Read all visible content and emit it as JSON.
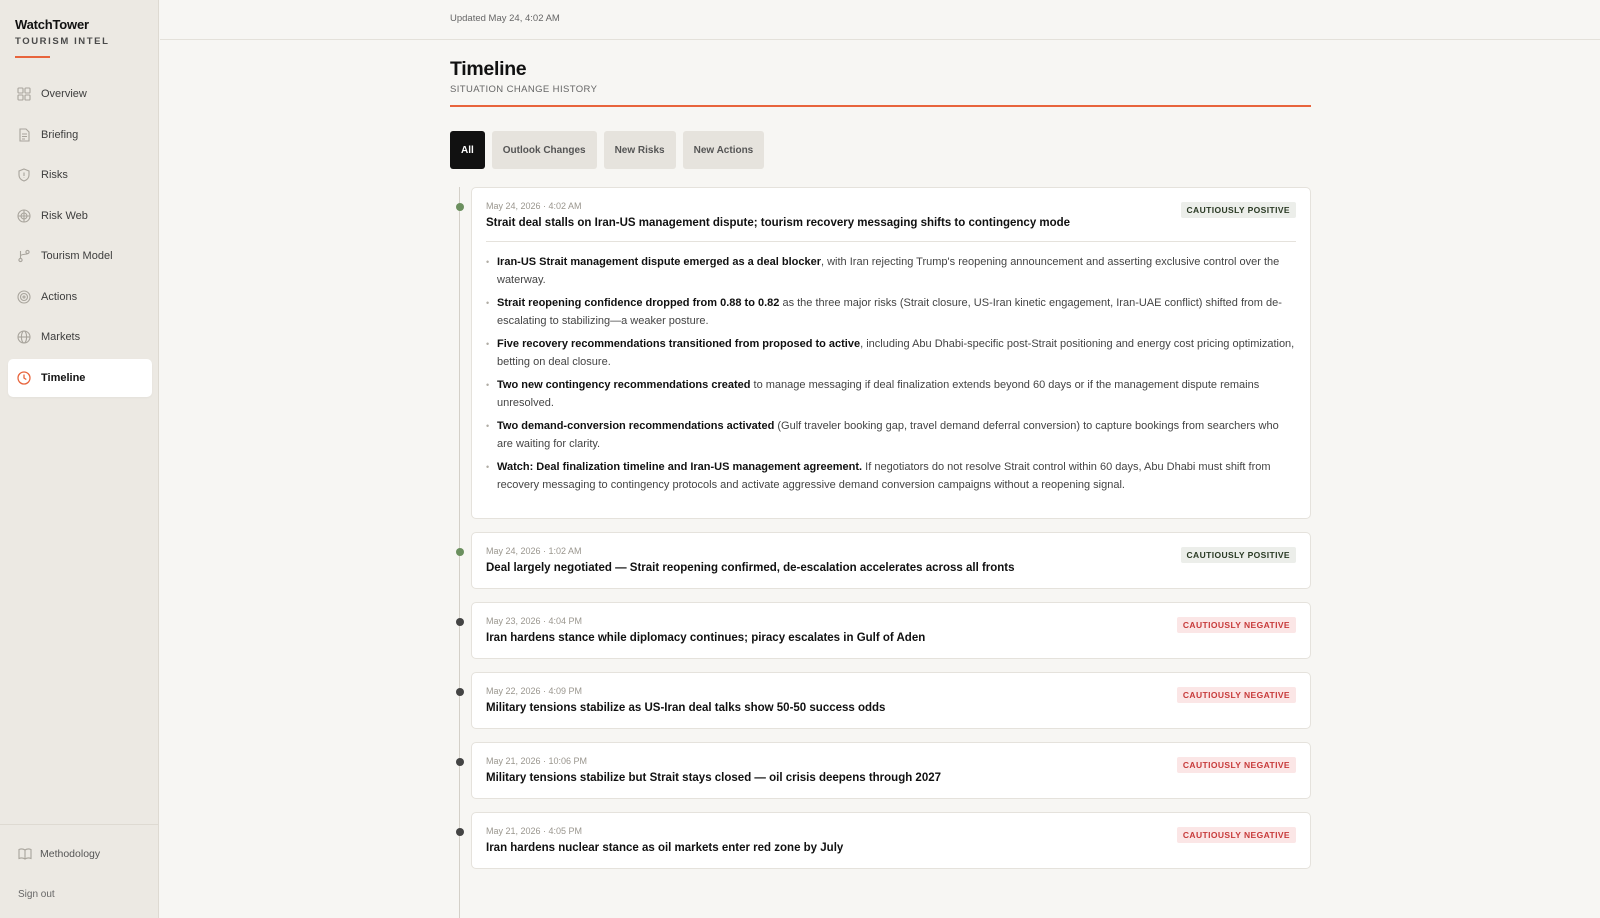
{
  "brand": {
    "name": "WatchTower",
    "subtitle": "TOURISM INTEL",
    "accent": "#e8643c"
  },
  "nav": [
    {
      "label": "Overview",
      "icon": "grid-icon",
      "active": false
    },
    {
      "label": "Briefing",
      "icon": "document-icon",
      "active": false
    },
    {
      "label": "Risks",
      "icon": "shield-icon",
      "active": false
    },
    {
      "label": "Risk Web",
      "icon": "web-icon",
      "active": false
    },
    {
      "label": "Tourism Model",
      "icon": "branch-icon",
      "active": false
    },
    {
      "label": "Actions",
      "icon": "target-icon",
      "active": false
    },
    {
      "label": "Markets",
      "icon": "globe-icon",
      "active": false
    },
    {
      "label": "Timeline",
      "icon": "clock-icon",
      "active": true
    }
  ],
  "footer": {
    "methodology": "Methodology",
    "sign_out": "Sign out"
  },
  "header": {
    "updated": "Updated May 24, 4:02 AM"
  },
  "page": {
    "title": "Timeline",
    "subtitle": "SITUATION CHANGE HISTORY"
  },
  "filters": [
    {
      "label": "All",
      "active": true
    },
    {
      "label": "Outlook Changes",
      "active": false
    },
    {
      "label": "New Risks",
      "active": false
    },
    {
      "label": "New Actions",
      "active": false
    }
  ],
  "entries": [
    {
      "date": "May 24, 2026 · 4:02 AM",
      "title": "Strait deal stalls on Iran-US management dispute; tourism recovery messaging shifts to contingency mode",
      "badge": "CAUTIOUSLY POSITIVE",
      "tone": "positive",
      "details": [
        {
          "bold": "Iran-US Strait management dispute emerged as a deal blocker",
          "text": ", with Iran rejecting Trump's reopening announcement and asserting exclusive control over the waterway."
        },
        {
          "bold": "Strait reopening confidence dropped from 0.88 to 0.82",
          "text": " as the three major risks (Strait closure, US-Iran kinetic engagement, Iran-UAE conflict) shifted from de-escalating to stabilizing—a weaker posture."
        },
        {
          "bold": "Five recovery recommendations transitioned from proposed to active",
          "text": ", including Abu Dhabi-specific post-Strait positioning and energy cost pricing optimization, betting on deal closure."
        },
        {
          "bold": "Two new contingency recommendations created",
          "text": " to manage messaging if deal finalization extends beyond 60 days or if the management dispute remains unresolved."
        },
        {
          "bold": "Two demand-conversion recommendations activated",
          "text": " (Gulf traveler booking gap, travel demand deferral conversion) to capture bookings from searchers who are waiting for clarity."
        },
        {
          "bold": "Watch: Deal finalization timeline and Iran-US management agreement.",
          "text": " If negotiators do not resolve Strait control within 60 days, Abu Dhabi must shift from recovery messaging to contingency protocols and activate aggressive demand conversion campaigns without a reopening signal."
        }
      ]
    },
    {
      "date": "May 24, 2026 · 1:02 AM",
      "title": "Deal largely negotiated — Strait reopening confirmed, de-escalation accelerates across all fronts",
      "badge": "CAUTIOUSLY POSITIVE",
      "tone": "positive"
    },
    {
      "date": "May 23, 2026 · 4:04 PM",
      "title": "Iran hardens stance while diplomacy continues; piracy escalates in Gulf of Aden",
      "badge": "CAUTIOUSLY NEGATIVE",
      "tone": "negative"
    },
    {
      "date": "May 22, 2026 · 4:09 PM",
      "title": "Military tensions stabilize as US-Iran deal talks show 50-50 success odds",
      "badge": "CAUTIOUSLY NEGATIVE",
      "tone": "negative"
    },
    {
      "date": "May 21, 2026 · 10:06 PM",
      "title": "Military tensions stabilize but Strait stays closed — oil crisis deepens through 2027",
      "badge": "CAUTIOUSLY NEGATIVE",
      "tone": "negative"
    },
    {
      "date": "May 21, 2026 · 4:05 PM",
      "title": "Iran hardens nuclear stance as oil markets enter red zone by July",
      "badge": "CAUTIOUSLY NEGATIVE",
      "tone": "negative"
    }
  ]
}
